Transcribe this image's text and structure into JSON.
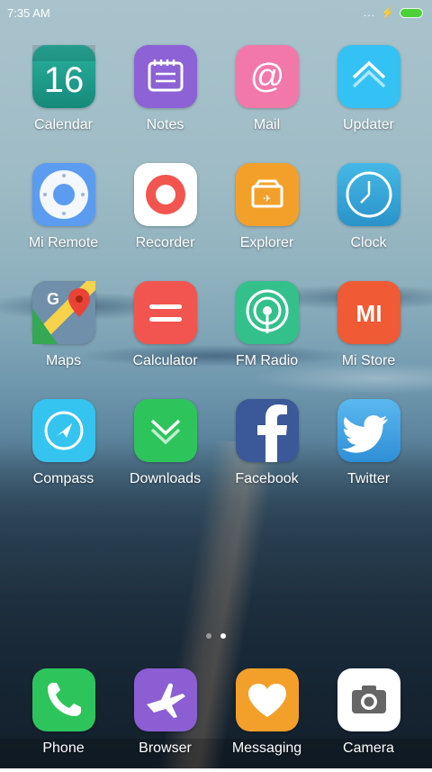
{
  "status": {
    "time": "7:35 AM",
    "dots": "...",
    "charging": "⚡",
    "battery_color": "#4cd137"
  },
  "apps": [
    {
      "label": "Calendar",
      "date": "16",
      "color": "#1e9b8a"
    },
    {
      "label": "Notes",
      "color": "#8c62d6"
    },
    {
      "label": "Mail",
      "color": "#f278aa"
    },
    {
      "label": "Updater",
      "color": "#34c2f4"
    },
    {
      "label": "Mi Remote",
      "color": "#5b9cf0"
    },
    {
      "label": "Recorder",
      "color": "#ffffff"
    },
    {
      "label": "Explorer",
      "color": "#f3a02b"
    },
    {
      "label": "Clock",
      "color": "#34a8d8"
    },
    {
      "label": "Maps",
      "color": "#4a6b8a"
    },
    {
      "label": "Calculator",
      "color": "#f2554f"
    },
    {
      "label": "FM Radio",
      "color": "#34c08b"
    },
    {
      "label": "Mi Store",
      "color": "#f05a35"
    },
    {
      "label": "Compass",
      "color": "#35c4f0"
    },
    {
      "label": "Downloads",
      "color": "#2ec45c"
    },
    {
      "label": "Facebook",
      "color": "#3b5998"
    },
    {
      "label": "Twitter",
      "color": "#2fa4ea"
    }
  ],
  "mistore_letters": "MI",
  "dock": [
    {
      "label": "Phone",
      "color": "#2ec45c"
    },
    {
      "label": "Browser",
      "color": "#8b5ed3"
    },
    {
      "label": "Messaging",
      "color": "#f3a02b"
    },
    {
      "label": "Camera",
      "color": "#ffffff"
    }
  ]
}
